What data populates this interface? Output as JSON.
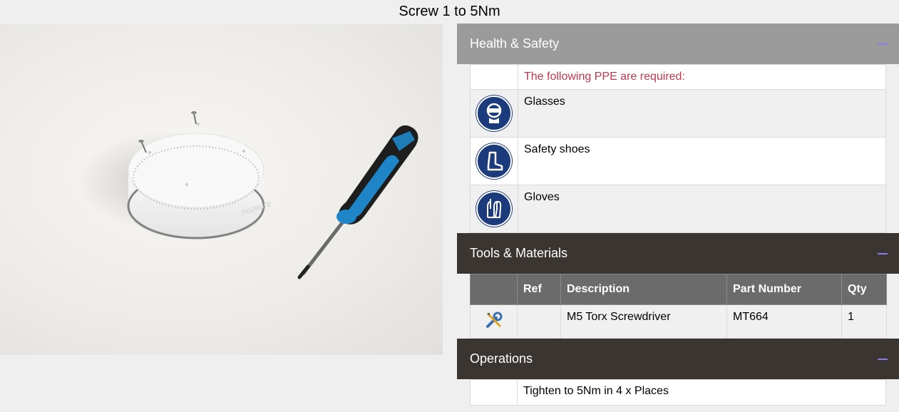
{
  "page": {
    "title": "Screw 1 to 5Nm"
  },
  "photo": {
    "description": ""
  },
  "health_safety": {
    "title": "Health & Safety",
    "collapse_icon": "minus-icon",
    "intro": "The following PPE are required:",
    "items": [
      {
        "label": "Glasses",
        "icon": "safety-glasses-icon"
      },
      {
        "label": "Safety shoes",
        "icon": "safety-shoes-icon"
      },
      {
        "label": "Gloves",
        "icon": "gloves-icon"
      }
    ]
  },
  "tools_materials": {
    "title": "Tools & Materials",
    "collapse_icon": "minus-icon",
    "columns": [
      "",
      "Ref",
      "Description",
      "Part Number",
      "Qty"
    ],
    "rows": [
      {
        "icon": "tool-icon",
        "ref": "",
        "description": "M5 Torx Screwdriver",
        "part_number": "MT664",
        "qty": "1"
      }
    ]
  },
  "operations": {
    "title": "Operations",
    "collapse_icon": "minus-icon",
    "rows": [
      {
        "text": "Tighten to 5Nm in 4 x Places"
      }
    ]
  },
  "colors": {
    "header_gray": "#9b9b9b",
    "header_dark": "#3b3532",
    "ppe_blue": "#1c3b7c",
    "accent": "#8b7cf0",
    "warning_text": "#c0384f"
  }
}
